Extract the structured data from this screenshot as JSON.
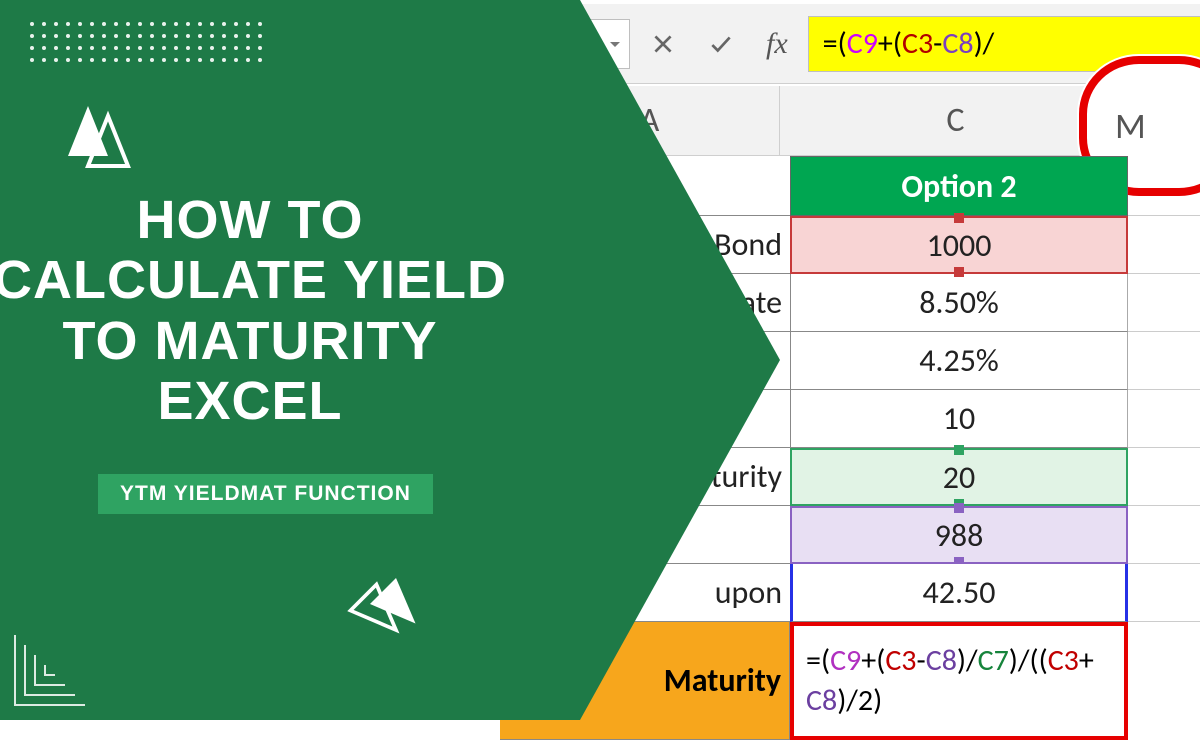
{
  "overlay": {
    "title": "HOW TO CALCULATE YIELD TO MATURITY EXCEL",
    "subtitle": "YTM YIELDMAT FUNCTION"
  },
  "formula_bar": {
    "fx_label": "fx",
    "formula_text": "=(C9+(C3-C8)/",
    "tokens": [
      {
        "t": "=",
        "c": "op"
      },
      {
        "t": "(",
        "c": "paren"
      },
      {
        "t": "C9",
        "c": "ref1"
      },
      {
        "t": "+(",
        "c": "op"
      },
      {
        "t": "C3",
        "c": "ref2"
      },
      {
        "t": "-",
        "c": "op"
      },
      {
        "t": "C8",
        "c": "ref3"
      },
      {
        "t": ")/",
        "c": "op"
      }
    ]
  },
  "columns": {
    "a": "A",
    "c": "C"
  },
  "bubble": {
    "text": "M"
  },
  "grid": {
    "header_c": "Option 2",
    "rows": [
      {
        "label": "Bond",
        "value": "1000",
        "hl": "red"
      },
      {
        "label": "Rate",
        "value": "8.50%",
        "hl": "none"
      },
      {
        "label": "",
        "value": "4.25%",
        "hl": "none"
      },
      {
        "label": "",
        "value": "10",
        "hl": "none"
      },
      {
        "label": "Maturity",
        "value": "20",
        "hl": "green"
      },
      {
        "label": "",
        "value": "988",
        "hl": "purple"
      },
      {
        "label": "upon",
        "value": "42.50",
        "hl": "blue"
      },
      {
        "label": "Maturity",
        "value_is_formula": true,
        "hl": "formula"
      }
    ]
  },
  "cell_formula": {
    "line1": "=(C9+(C3-C8)/",
    "line2": "C7)/((C3+C8)/2)"
  },
  "colors": {
    "brand_green": "#1e7a47",
    "accent_green": "#2fa362",
    "excel_green": "#00a651",
    "highlight_yellow": "#ffff00",
    "warn_red": "#e60000",
    "orange_header": "#f7a61c"
  }
}
